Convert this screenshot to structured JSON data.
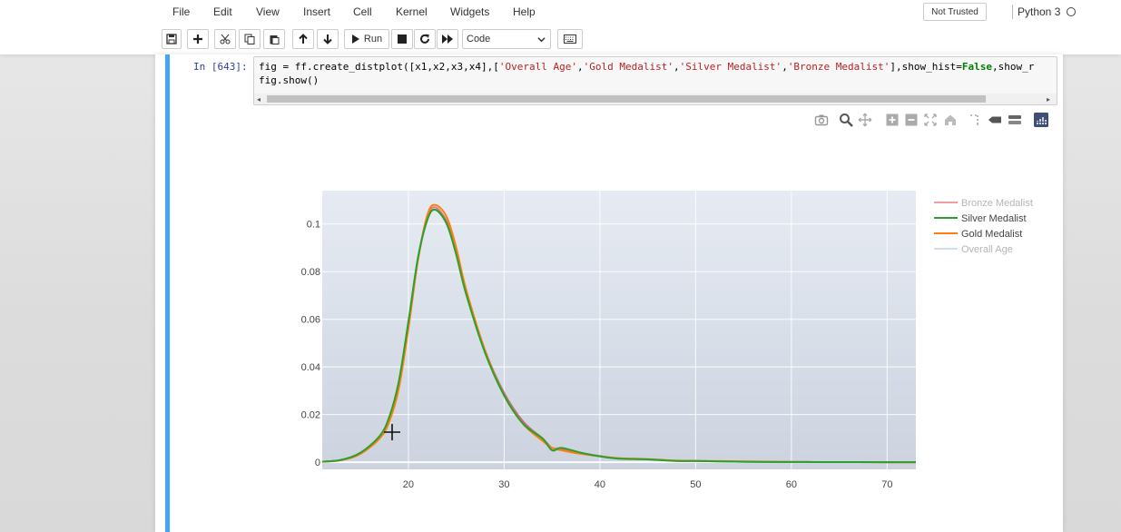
{
  "menu": {
    "items": [
      "File",
      "Edit",
      "View",
      "Insert",
      "Cell",
      "Kernel",
      "Widgets",
      "Help"
    ],
    "trust_status": "Not Trusted",
    "kernel": "Python 3"
  },
  "toolbar": {
    "run_label": "Run",
    "cell_type": "Code"
  },
  "cell": {
    "prompt": "In [643]:",
    "code_line1_a": "fig = ff.create_distplot([x1,x2,x3,x4],[",
    "code_str1": "'Overall Age'",
    "code_comma1": ",",
    "code_str2": "'Gold Medalist'",
    "code_comma2": ",",
    "code_str3": "'Silver Medalist'",
    "code_comma3": ",",
    "code_str4": "'Bronze Medalist'",
    "code_line1_b": "],show_hist=",
    "code_kw": "False",
    "code_line1_c": ",show_r",
    "code_line2": "fig.show()"
  },
  "chart_data": {
    "type": "line",
    "title": "",
    "xlabel": "",
    "ylabel": "",
    "xlim": [
      11,
      73
    ],
    "ylim": [
      -0.003,
      0.114
    ],
    "xticks": [
      20,
      30,
      40,
      50,
      60,
      70
    ],
    "xtick_labels": [
      "20",
      "30",
      "40",
      "50",
      "60",
      "70"
    ],
    "yticks": [
      0,
      0.02,
      0.04,
      0.06,
      0.08,
      0.1
    ],
    "ytick_labels": [
      "0",
      "0.02",
      "0.04",
      "0.06",
      "0.08",
      "0.1"
    ],
    "grid": true,
    "legend_position": "right",
    "series": [
      {
        "name": "Overall Age",
        "color": "#9fb0cf",
        "x": [
          11,
          13,
          15,
          17,
          18,
          19,
          20,
          21,
          22,
          22.8,
          24,
          25,
          26,
          28,
          30,
          32,
          34,
          35,
          36,
          38,
          40,
          42,
          45,
          48,
          50,
          55,
          60,
          65,
          70,
          73
        ],
        "y": [
          0.0002,
          0.001,
          0.004,
          0.011,
          0.018,
          0.033,
          0.058,
          0.085,
          0.102,
          0.106,
          0.101,
          0.088,
          0.072,
          0.047,
          0.029,
          0.017,
          0.01,
          0.006,
          0.006,
          0.004,
          0.0025,
          0.0015,
          0.0012,
          0.0006,
          0.0005,
          0.0002,
          0.0001,
          5e-05,
          2e-05,
          1e-05
        ]
      },
      {
        "name": "Gold Medalist",
        "color": "#ff7f0e",
        "x": [
          11,
          13,
          15,
          17,
          18,
          19,
          20,
          21,
          22,
          22.8,
          24,
          25,
          26,
          28,
          30,
          32,
          34,
          35,
          36,
          38,
          40,
          42,
          45,
          48,
          50,
          55,
          60,
          65,
          70,
          73
        ],
        "y": [
          0.0002,
          0.0009,
          0.0035,
          0.01,
          0.017,
          0.031,
          0.056,
          0.085,
          0.104,
          0.108,
          0.103,
          0.09,
          0.073,
          0.047,
          0.028,
          0.016,
          0.009,
          0.006,
          0.005,
          0.0035,
          0.0025,
          0.0017,
          0.0013,
          0.0007,
          0.0006,
          0.0003,
          0.0001,
          5e-05,
          2e-05,
          1e-05
        ]
      },
      {
        "name": "Silver Medalist",
        "color": "#2ca02c",
        "x": [
          11,
          13,
          15,
          17,
          18,
          19,
          20,
          21,
          22,
          22.8,
          24,
          25,
          26,
          28,
          30,
          32,
          34,
          35,
          36,
          38,
          40,
          42,
          45,
          48,
          50,
          55,
          60,
          65,
          70,
          73
        ],
        "y": [
          0.0002,
          0.001,
          0.004,
          0.011,
          0.019,
          0.034,
          0.059,
          0.086,
          0.102,
          0.106,
          0.1,
          0.087,
          0.071,
          0.046,
          0.028,
          0.016,
          0.01,
          0.005,
          0.006,
          0.004,
          0.0025,
          0.0015,
          0.0012,
          0.0005,
          0.0005,
          0.0002,
          0.0001,
          5e-05,
          2e-05,
          1e-05
        ]
      },
      {
        "name": "Bronze Medalist",
        "color": "#d62728",
        "x": [
          11,
          13,
          15,
          17,
          18,
          19,
          20,
          21,
          22,
          22.8,
          24,
          25,
          26,
          28,
          30,
          32,
          34,
          35,
          36,
          38,
          40,
          42,
          45,
          48,
          50,
          55,
          60,
          65,
          70,
          73
        ],
        "y": [
          0.0002,
          0.0009,
          0.0036,
          0.0105,
          0.018,
          0.032,
          0.057,
          0.085,
          0.103,
          0.107,
          0.101,
          0.089,
          0.072,
          0.047,
          0.029,
          0.017,
          0.01,
          0.006,
          0.0055,
          0.0038,
          0.0026,
          0.0016,
          0.0012,
          0.0006,
          0.0005,
          0.0002,
          0.0001,
          5e-05,
          2e-05,
          1e-05
        ]
      }
    ],
    "legend_order": [
      "Bronze Medalist",
      "Silver Medalist",
      "Gold Medalist",
      "Overall Age"
    ],
    "legend_faded": [
      "Bronze Medalist",
      "Overall Age"
    ]
  }
}
